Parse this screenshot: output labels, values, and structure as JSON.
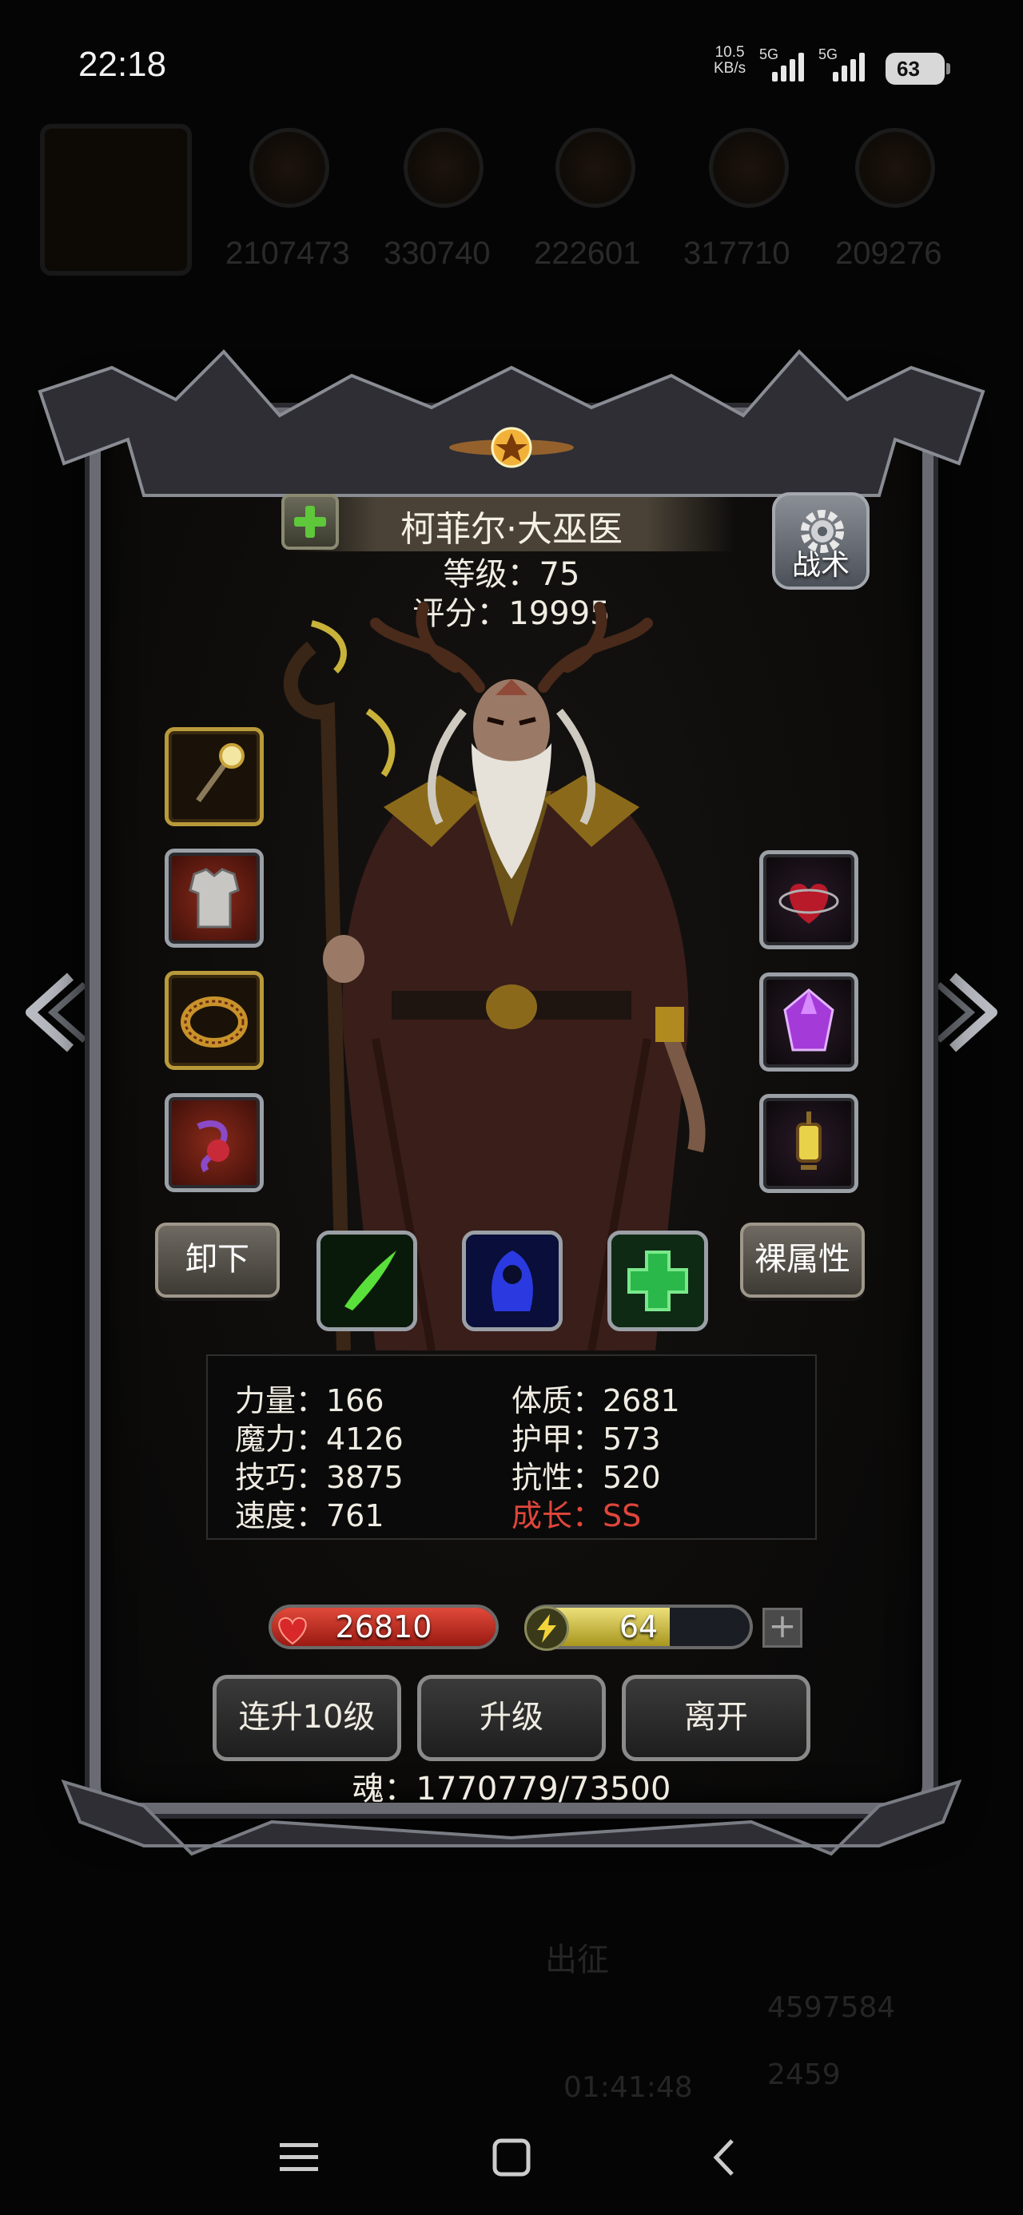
{
  "status_bar": {
    "time": "22:18",
    "net_speed_value": "10.5",
    "net_speed_unit": "KB/s",
    "signal_1": "5G",
    "signal_2": "5G",
    "battery": "63"
  },
  "background": {
    "resources": [
      "2107473",
      "330740",
      "222601",
      "317710",
      "209276"
    ],
    "label_march": "出征",
    "timer": "01:41:48",
    "gold": "4597584",
    "gems": "2459"
  },
  "hero": {
    "name": "柯菲尔·大巫医",
    "level": "等级：75",
    "score": "评分：19995"
  },
  "buttons": {
    "tactics": "战术",
    "unequip": "卸下",
    "base_attributes": "裸属性",
    "level_up_10": "连升10级",
    "level_up": "升级",
    "leave": "离开",
    "add_energy": "+"
  },
  "stats": {
    "strength": "力量：166",
    "magic": "魔力：4126",
    "skill": "技巧：3875",
    "speed": "速度：761",
    "constitution": "体质：2681",
    "armor": "护甲：573",
    "resistance": "抗性：520",
    "growth": "成长：SS"
  },
  "bars": {
    "hp": "26810",
    "hp_fill_fraction": 1.0,
    "energy": "64",
    "energy_fill_fraction": 0.64
  },
  "soul": "魂：1770779/73500",
  "colors": {
    "accent_gold": "#b99a3a",
    "growth_red": "#e0463a",
    "hp_red": "#e04a3a",
    "energy_yellow": "#ece07a"
  },
  "icons": {
    "equipment_left": [
      "staff-icon",
      "armor-icon",
      "ring-icon",
      "amulet-icon"
    ],
    "equipment_right": [
      "heart-gem-icon",
      "purple-crystal-icon",
      "lantern-icon"
    ],
    "skills": [
      "green-slash-icon",
      "blue-shadow-icon",
      "green-cross-icon"
    ]
  }
}
